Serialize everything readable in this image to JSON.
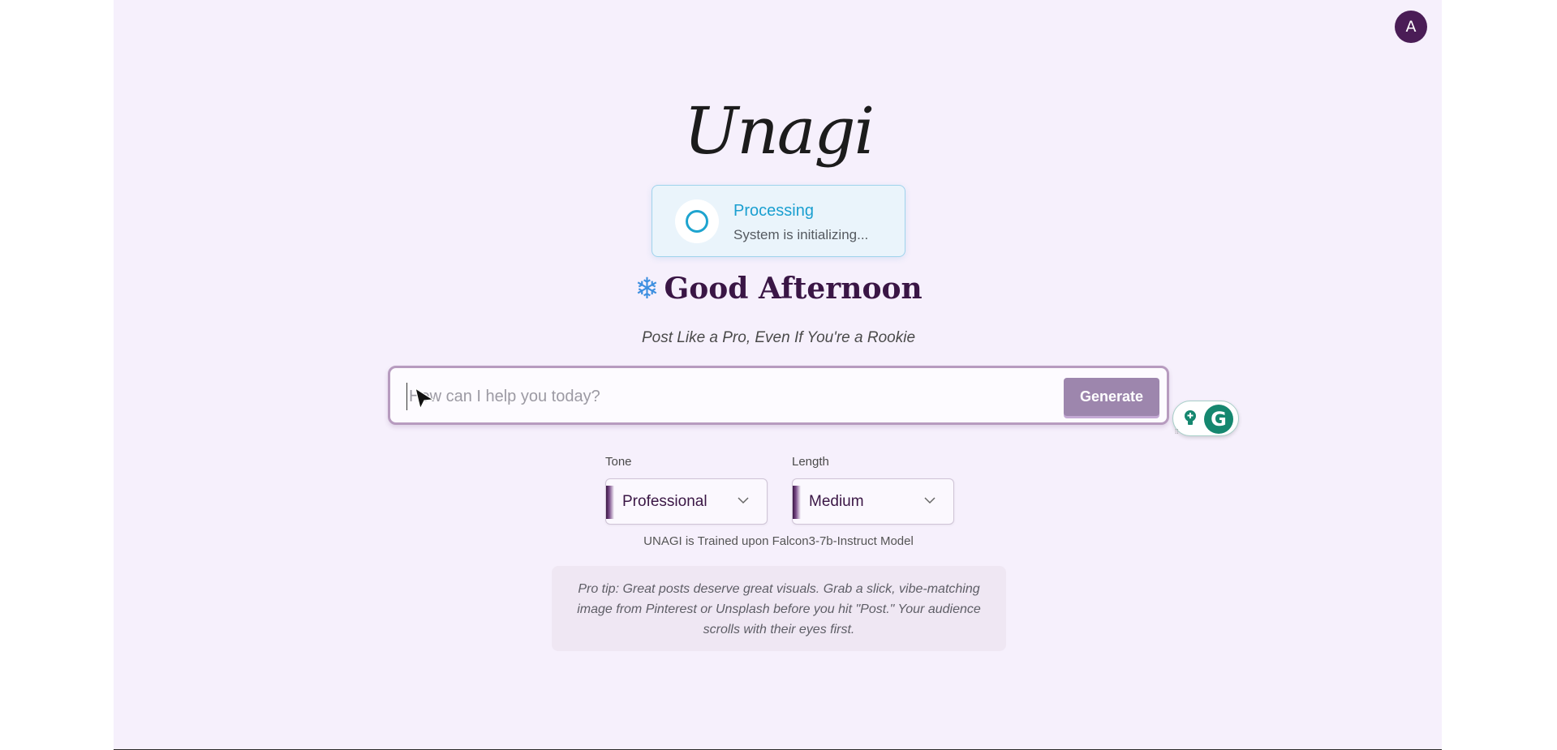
{
  "app": {
    "logo": "Unagi",
    "avatar_initial": "A"
  },
  "status": {
    "title": "Processing",
    "message": "System is initializing...",
    "accent_color": "#1ea4cf"
  },
  "greeting": {
    "icon": "snowflake-icon",
    "glyph": "❄",
    "text": "Good Afternoon"
  },
  "tagline": "Post Like a Pro, Even If You're a Rookie",
  "prompt": {
    "placeholder": "How can I help you today?",
    "value": "",
    "generate_label": "Generate"
  },
  "options": {
    "tone": {
      "label": "Tone",
      "selected": "Professional"
    },
    "length": {
      "label": "Length",
      "selected": "Medium"
    }
  },
  "model_note": "UNAGI is Trained upon Falcon3-7b-Instruct Model",
  "tip": "Pro tip: Great posts deserve great visuals. Grab a slick, vibe-matching image from Pinterest or Unsplash before you hit \"Post.\" Your audience scrolls with their eyes first.",
  "extensions": {
    "grammarly_letter": "G"
  },
  "colors": {
    "background": "#f6f0fc",
    "brand_dark": "#3a1645",
    "button": "#9d86ad",
    "grammarly": "#15876f"
  }
}
